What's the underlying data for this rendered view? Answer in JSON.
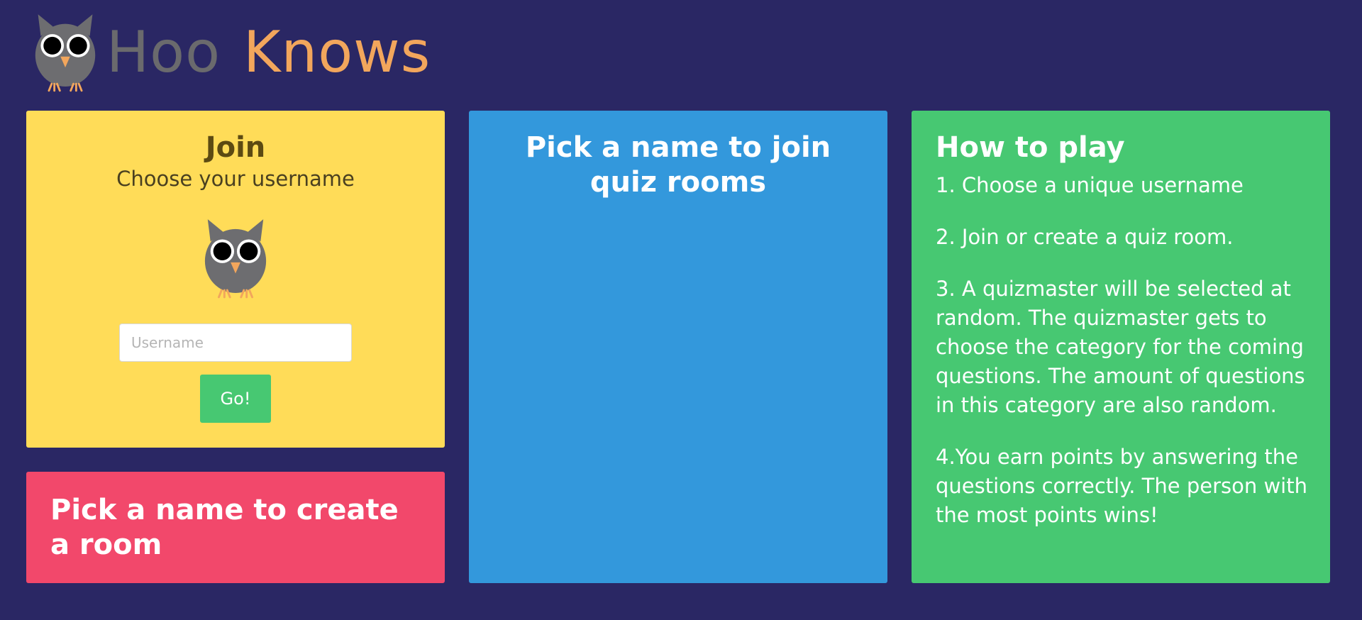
{
  "header": {
    "brand_word1": "Hoo",
    "brand_word2": "Knows"
  },
  "join_card": {
    "title": "Join",
    "subtitle": "Choose your username",
    "username_placeholder": "Username",
    "username_value": "",
    "go_label": "Go!"
  },
  "create_card": {
    "title": "Pick a name to create a room"
  },
  "rooms_card": {
    "title": "Pick a name to join quiz rooms"
  },
  "howto_card": {
    "title": "How to play",
    "steps": [
      "1. Choose a unique username",
      "2. Join or create a quiz room.",
      "3. A quizmaster will be selected at random. The quizmaster gets to choose the category for the coming questions. The amount of questions in this category are also random.",
      "4.You earn points by answering the questions correctly. The person with the most points wins!"
    ]
  },
  "colors": {
    "background": "#2a2764",
    "join_card": "#ffdc58",
    "create_card": "#f2486b",
    "rooms_card": "#3398dc",
    "howto_card": "#47c872",
    "brand_grey": "#6a6a6d",
    "brand_orange": "#f2a65c"
  },
  "icons": {
    "logo": "owl-icon",
    "join_mascot": "owl-icon"
  }
}
